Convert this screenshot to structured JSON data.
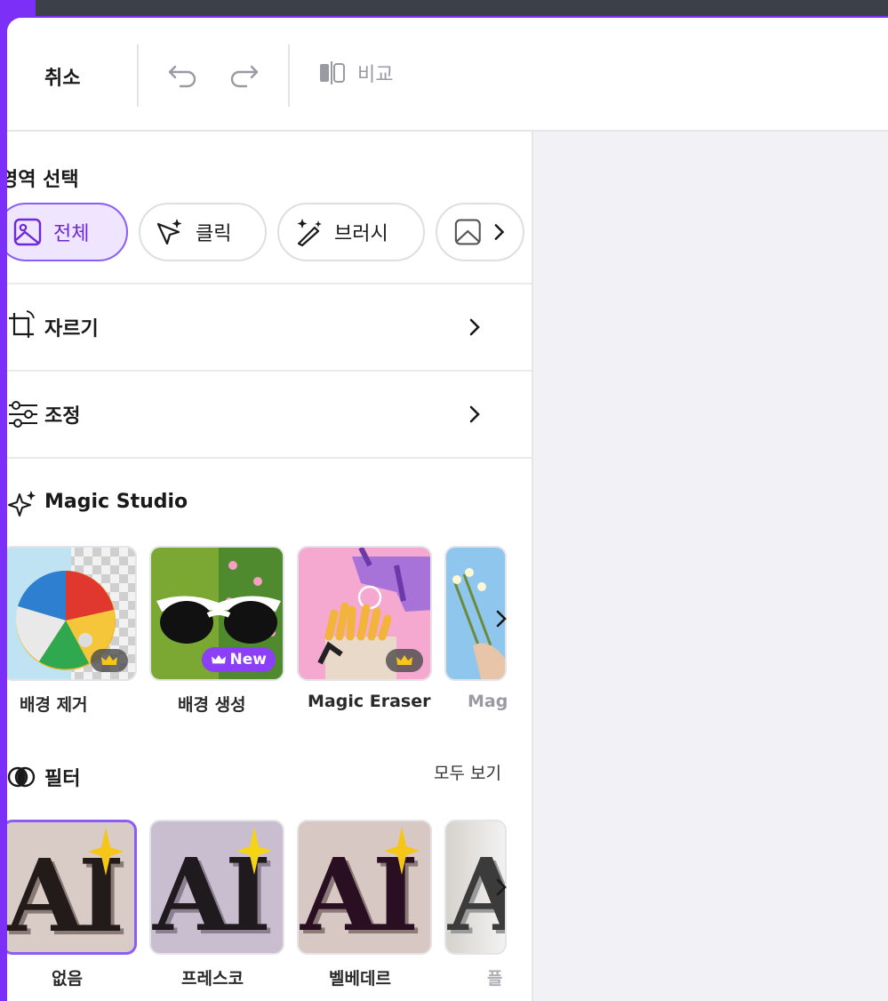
{
  "toolbar": {
    "cancel_label": "취소",
    "compare_label": "비교"
  },
  "region_select": {
    "title": "영역 선택",
    "chips": [
      {
        "label": "전체",
        "active": true
      },
      {
        "label": "클릭",
        "active": false
      },
      {
        "label": "브러시",
        "active": false
      }
    ]
  },
  "rows": {
    "crop_label": "자르기",
    "adjust_label": "조정"
  },
  "magic_studio": {
    "title": "Magic Studio",
    "items": [
      {
        "label": "배경 제거",
        "badge": "crown"
      },
      {
        "label": "배경 생성",
        "badge": "New"
      },
      {
        "label": "Magic Eraser",
        "badge": "crown"
      },
      {
        "label": "Mag"
      }
    ]
  },
  "filters": {
    "title": "필터",
    "see_all": "모두 보기",
    "items": [
      {
        "label": "없음",
        "selected": true,
        "bg": "#d9cbc6",
        "fg": "#231a1a"
      },
      {
        "label": "프레스코",
        "selected": false,
        "bg": "#c9bdd0",
        "fg": "#1f1a1e"
      },
      {
        "label": "벨베데르",
        "selected": false,
        "bg": "#d8c8c4",
        "fg": "#2a0f22"
      },
      {
        "label": "플",
        "selected": false,
        "bg": "#d6d2cc",
        "fg": "#3b3b3b"
      }
    ],
    "ai_glyph": "AI"
  },
  "colors": {
    "accent": "#8b5cf6",
    "frame": "#7b2ff7",
    "canvas": "#f1f1f6"
  }
}
